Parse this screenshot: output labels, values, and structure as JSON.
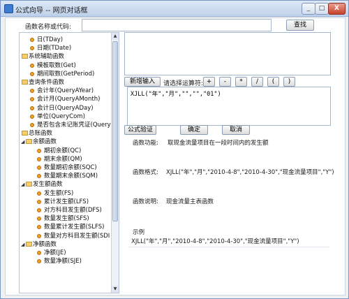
{
  "window": {
    "title": "公式向导 -- 网页对话框",
    "minimize": "_",
    "maximize": "□",
    "close": "X"
  },
  "search": {
    "label": "函数名称或代码:",
    "value": "",
    "button": "查找"
  },
  "tree": {
    "items": [
      {
        "label": "日(TDay)",
        "kind": "item"
      },
      {
        "label": "日期(TDate)",
        "kind": "item"
      },
      {
        "label": "系统辅助函数",
        "kind": "folder"
      },
      {
        "label": "模板取数(Get)",
        "kind": "item"
      },
      {
        "label": "期间取数(GetPeriod)",
        "kind": "item"
      },
      {
        "label": "查询条件函数",
        "kind": "folder"
      },
      {
        "label": "会计年(QueryAYear)",
        "kind": "item"
      },
      {
        "label": "会计月(QueryAMonth)",
        "kind": "item"
      },
      {
        "label": "会计日(QueryADay)",
        "kind": "item"
      },
      {
        "label": "单位(QueryCom)",
        "kind": "item"
      },
      {
        "label": "是否包含未记账凭证(QueryP",
        "kind": "item"
      },
      {
        "label": "总账函数",
        "kind": "folder"
      },
      {
        "label": "余额函数",
        "kind": "subfolder"
      },
      {
        "label": "期初余额(QC)",
        "kind": "leaf"
      },
      {
        "label": "期末余额(QM)",
        "kind": "leaf"
      },
      {
        "label": "数量期初余额(SQC)",
        "kind": "leaf"
      },
      {
        "label": "数量期末余额(SQM)",
        "kind": "leaf"
      },
      {
        "label": "发生额函数",
        "kind": "subfolder"
      },
      {
        "label": "发生额(FS)",
        "kind": "leaf"
      },
      {
        "label": "累计发生额(LFS)",
        "kind": "leaf"
      },
      {
        "label": "对方科目发生额(DFS)",
        "kind": "leaf"
      },
      {
        "label": "数量发生额(SFS)",
        "kind": "leaf"
      },
      {
        "label": "数量累计发生额(SLFS)",
        "kind": "leaf"
      },
      {
        "label": "数量对方科目发生额(SDI",
        "kind": "leaf"
      },
      {
        "label": "净额函数",
        "kind": "subfolder"
      },
      {
        "label": "净额(JE)",
        "kind": "leaf"
      },
      {
        "label": "数量净额(SJE)",
        "kind": "leaf"
      }
    ],
    "scroll_up": "▲",
    "scroll_down": "▼"
  },
  "ops": {
    "new_button": "新增输入",
    "label": "请选择运算符:",
    "operators": [
      "+",
      "-",
      "*",
      "/",
      "(",
      ")"
    ]
  },
  "editor": {
    "value": "XJLL(\"年\",\"月\",\"\",\"\",\"01\")"
  },
  "actions": {
    "verify": "公式验证",
    "ok": "确定",
    "cancel": "取消"
  },
  "info": {
    "function_label": "函数功能:",
    "function_value": "取现金流量项目在一段时间内的发生额",
    "format_label": "函数格式:",
    "format_value": "XJLL(\"年\",\"月\",\"2010-4-8\",\"2010-4-30\",\"现金流量项目\",\"Y\")",
    "desc_label": "函数说明:",
    "desc_value": "现金流量主表函数",
    "example_label": "示例",
    "example_value": "XJLL(\"年\",\"月\",\"2010-4-8\",\"2010-4-30\",\"现金流量项目\",\"Y\")"
  },
  "colors": {
    "titlebar": "#bfd1ea",
    "border": "#a4b5cf",
    "folder": "#f4cf6a",
    "bullet": "#f0a020"
  }
}
